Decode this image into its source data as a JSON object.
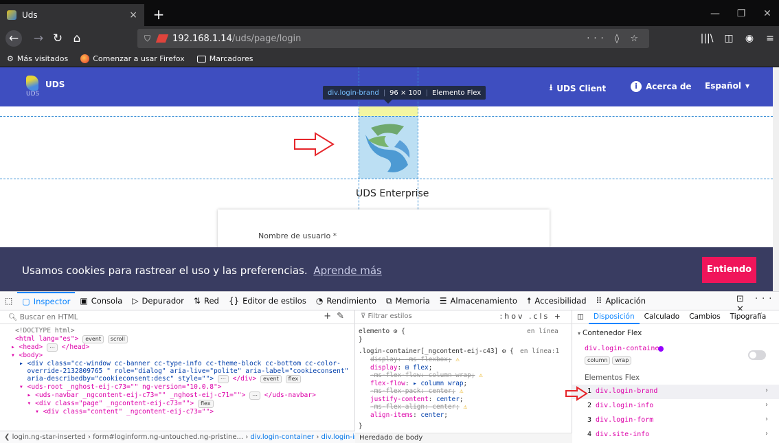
{
  "browser": {
    "tab_title": "Uds",
    "tab_close": "×",
    "new_tab": "+",
    "window_buttons": [
      "—",
      "❐",
      "✕"
    ],
    "url_host": "192.168.1.14",
    "url_path": "/uds/page/login",
    "url_actions": "··· ◊ ☆",
    "toolbar_icons": [
      "|||\\",
      "◫",
      "◉",
      "≡"
    ],
    "bookmarks": [
      "Más visitados",
      "Comenzar a usar Firefox",
      "Marcadores"
    ]
  },
  "site": {
    "brand_name": "UDS",
    "brand_sub": "UDS",
    "nav_client": "UDS Client",
    "nav_about": "Acerca de",
    "nav_language": "Español",
    "tooltip_selector": "div.login-brand",
    "tooltip_size": "96 × 100",
    "tooltip_type": "Elemento Flex",
    "enterprise_title": "UDS Enterprise",
    "username_label": "Nombre de usuario *",
    "cookie_text": "Usamos cookies para rastrear el uso y las preferencias.",
    "cookie_link": "Aprende más",
    "cookie_button": "Entiendo"
  },
  "devtools": {
    "tabs": [
      "Inspector",
      "Consola",
      "Depurador",
      "Red",
      "Editor de estilos",
      "Rendimiento",
      "Memoria",
      "Almacenamiento",
      "Accesibilidad",
      "Aplicación"
    ],
    "search_placeholder": "Buscar en HTML",
    "filter_placeholder": "Filtrar estilos",
    "filter_actions": ":hov .cls +",
    "html_lines": {
      "l1": "<!DOCTYPE html>",
      "l2_a": "<html lang=\"es\">",
      "l2_badges": [
        "event",
        "scroll"
      ],
      "l3": "▸ <head>",
      "l3_b": "</head>",
      "l4": "▾ <body>",
      "l5": "▸ <div class=\"cc-window cc-banner cc-type-info cc-theme-block cc-bottom cc-color-",
      "l6": "  override-2132809765 \" role=\"dialog\" aria-live=\"polite\" aria-label=\"cookieconsent\"",
      "l7": "  aria-describedby=\"cookieconsent:desc\" style=\"\">",
      "l7_b": "</div>",
      "l7_badges": [
        "event",
        "flex"
      ],
      "l8": "▾ <uds-root _nghost-eij-c73=\"\" ng-version=\"10.0.8\">",
      "l9": "  ▸ <uds-navbar _ngcontent-eij-c73=\"\" _nghost-eij-c71=\"\">",
      "l9_b": "</uds-navbar>",
      "l10": "  ▾ <div class=\"page\" _ngcontent-eij-c73=\"\">",
      "l10_badge": "flex",
      "l11": "    ▾ <div class=\"content\" _ngcontent-eij-c73=\"\">"
    },
    "breadcrumbs": [
      "login.ng-star-inserted",
      "form#loginform.ng-untouched.ng-pristine...",
      "div.login-container",
      "div.login-info"
    ],
    "rules": {
      "element_selector": "elemento ⚙ {",
      "element_source": "en línea",
      "close_brace": "}",
      "container_selector": ".login-container[_ngcontent-eij-c43] ⚙ {",
      "container_source": "en línea:1",
      "decls": [
        {
          "prop": "display",
          "val": "-ms-flexbox",
          "strike": true,
          "warn": true
        },
        {
          "prop": "display",
          "val": "⊞ flex",
          "strike": false,
          "warn": false
        },
        {
          "prop": "-ms-flex-flow",
          "val": "column wrap",
          "strike": true,
          "warn": true
        },
        {
          "prop": "flex-flow",
          "val": "▸ column wrap",
          "strike": false,
          "warn": false
        },
        {
          "prop": "-ms-flex-pack",
          "val": "center",
          "strike": true,
          "warn": true
        },
        {
          "prop": "justify-content",
          "val": "center",
          "strike": false,
          "warn": false
        },
        {
          "prop": "-ms-flex-align",
          "val": "center",
          "strike": true,
          "warn": true
        },
        {
          "prop": "align-items",
          "val": "center",
          "strike": false,
          "warn": false
        }
      ],
      "inherited": "Heredado de body"
    },
    "layout": {
      "tabs": [
        "Disposición",
        "Calculado",
        "Cambios",
        "Tipografía"
      ],
      "flex_container_title": "Contenedor Flex",
      "container_name": "div.login-container",
      "container_badges": [
        "column",
        "wrap"
      ],
      "flex_items_title": "Elementos Flex",
      "items": [
        {
          "num": "1",
          "name": "div.login-brand"
        },
        {
          "num": "2",
          "name": "div.login-info"
        },
        {
          "num": "3",
          "name": "div.login-form"
        },
        {
          "num": "4",
          "name": "div.site-info"
        }
      ]
    },
    "actions": "⊡ ··· ✕",
    "colors": {
      "accent": "#0a84ff",
      "uds_nav": "#3e4ec0",
      "cookie_button": "#f0155a",
      "arrow": "#e6262b"
    }
  }
}
